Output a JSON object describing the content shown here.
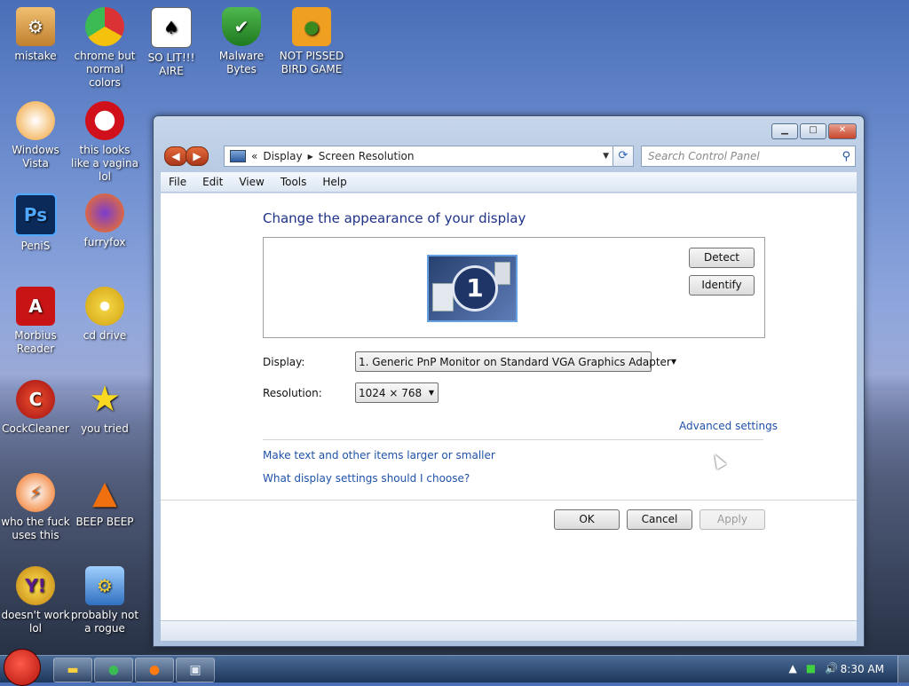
{
  "desktop": {
    "icons": [
      {
        "label": "mistake"
      },
      {
        "label": "chrome but normal colors"
      },
      {
        "label": "SO LIT!!! AIRE"
      },
      {
        "label": "Malware Bytes"
      },
      {
        "label": "NOT PISSED BIRD GAME"
      },
      {
        "label": "Windows Vista"
      },
      {
        "label": "this looks like a vagina lol"
      },
      {
        "label": "PeniS"
      },
      {
        "label": "furryfox"
      },
      {
        "label": "Morbius Reader"
      },
      {
        "label": "cd drive"
      },
      {
        "label": "CockCleaner"
      },
      {
        "label": "you tried"
      },
      {
        "label": "who the fuck uses this"
      },
      {
        "label": "BEEP BEEP"
      },
      {
        "label": "doesn't work lol"
      },
      {
        "label": "probably not a rogue"
      }
    ]
  },
  "window": {
    "breadcrumb": {
      "root": "Display",
      "current": "Screen Resolution"
    },
    "search_placeholder": "Search Control Panel",
    "menu": [
      "File",
      "Edit",
      "View",
      "Tools",
      "Help"
    ],
    "heading": "Change the appearance of your display",
    "monitor_number": "1",
    "detect_label": "Detect",
    "identify_label": "Identify",
    "display_label": "Display:",
    "display_value": "1. Generic PnP Monitor on Standard VGA Graphics Adapter",
    "resolution_label": "Resolution:",
    "resolution_value": "1024 × 768",
    "advanced_link": "Advanced settings",
    "link_text_size": "Make text and other items larger or smaller",
    "link_help": "What display settings should I choose?",
    "ok_label": "OK",
    "cancel_label": "Cancel",
    "apply_label": "Apply"
  },
  "taskbar": {
    "clock": "8:30 AM"
  },
  "colors": {
    "link": "#1f52a8",
    "heading": "#1e3287"
  }
}
